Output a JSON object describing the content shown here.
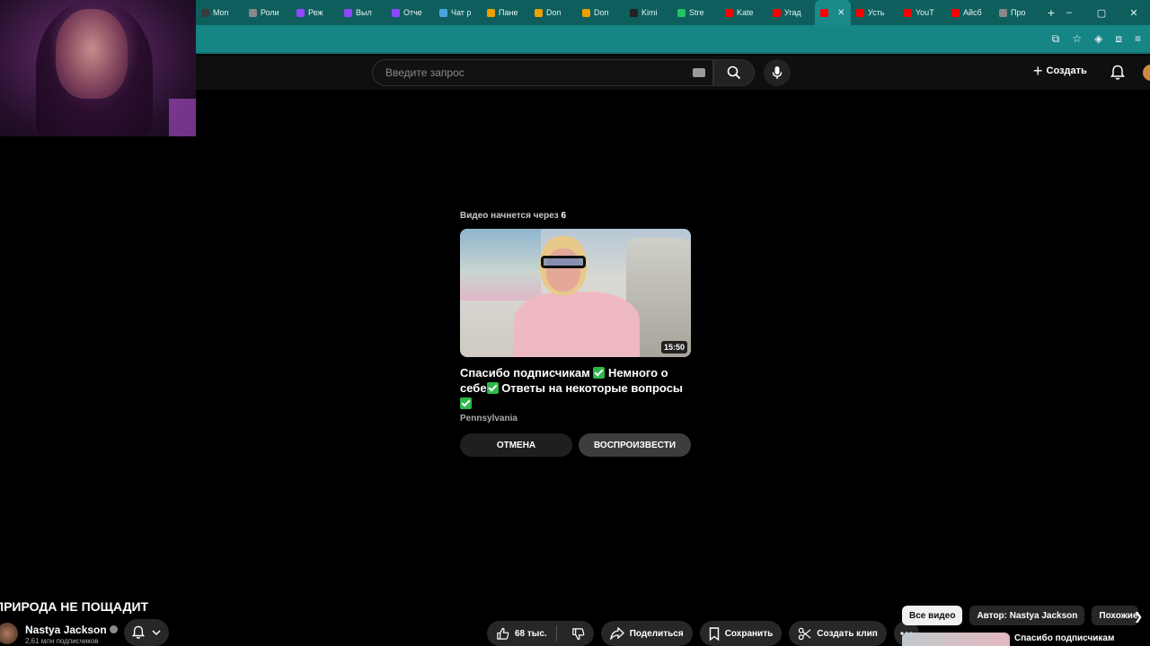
{
  "browser": {
    "tabs": [
      {
        "label": "Mon",
        "color": "#3a3a3a"
      },
      {
        "label": "Роли",
        "color": "#888888"
      },
      {
        "label": "Реж",
        "color": "#9146ff"
      },
      {
        "label": "Выл",
        "color": "#9146ff"
      },
      {
        "label": "Отче",
        "color": "#9146ff"
      },
      {
        "label": "Чат р",
        "color": "#4aa3df"
      },
      {
        "label": "Пане",
        "color": "#f0a000"
      },
      {
        "label": "Don",
        "color": "#f0a000"
      },
      {
        "label": "Don",
        "color": "#f0a000"
      },
      {
        "label": "Kimi",
        "color": "#222222"
      },
      {
        "label": "Stre",
        "color": "#22c55e"
      },
      {
        "label": "Kate",
        "color": "#ff0000"
      },
      {
        "label": "Угад",
        "color": "#ff0000"
      },
      {
        "label": "",
        "color": "#ff0000",
        "active": true
      },
      {
        "label": "Усть",
        "color": "#ff0000"
      },
      {
        "label": "YouT",
        "color": "#ff0000"
      },
      {
        "label": "Айсб",
        "color": "#ff0000"
      },
      {
        "label": "Про",
        "color": "#888888"
      }
    ],
    "new_tab": "+",
    "controls": {
      "minimize": "–",
      "maximize": "▢",
      "close": "✕"
    },
    "tool_icons": [
      "install-icon",
      "star-icon",
      "extension-badge-icon",
      "puzzle-icon",
      "playlist-icon"
    ]
  },
  "header": {
    "search_placeholder": "Введите запрос",
    "create_label": "Создать",
    "create_plus": "+"
  },
  "autoplay": {
    "next_prefix": "Видео начнется через",
    "countdown": "6",
    "duration": "15:50",
    "title_part1": "Спасибо подписчикам",
    "title_part2": "Немного о себе",
    "title_part3": "Ответы на некоторые вопросы",
    "channel": "Pennsylvania",
    "cancel_label": "ОТМЕНА",
    "play_label": "ВОСПРОИЗВЕСТИ"
  },
  "video": {
    "title": "ПРИРОДА НЕ ПОЩАДИТ",
    "channel_name": "Nastya Jackson",
    "subscribers": "2,61 млн подписчиков",
    "likes": "68 тыс.",
    "share_label": "Поделиться",
    "save_label": "Сохранить",
    "clip_label": "Создать клип"
  },
  "related": {
    "chips": [
      "Все видео",
      "Автор: Nastya Jackson",
      "Похожие"
    ],
    "first_title": "Спасибо подписчикам"
  },
  "colors": {
    "browser_frame": "#0f5e5e",
    "background": "#000000",
    "check_green": "#2fb84a"
  }
}
